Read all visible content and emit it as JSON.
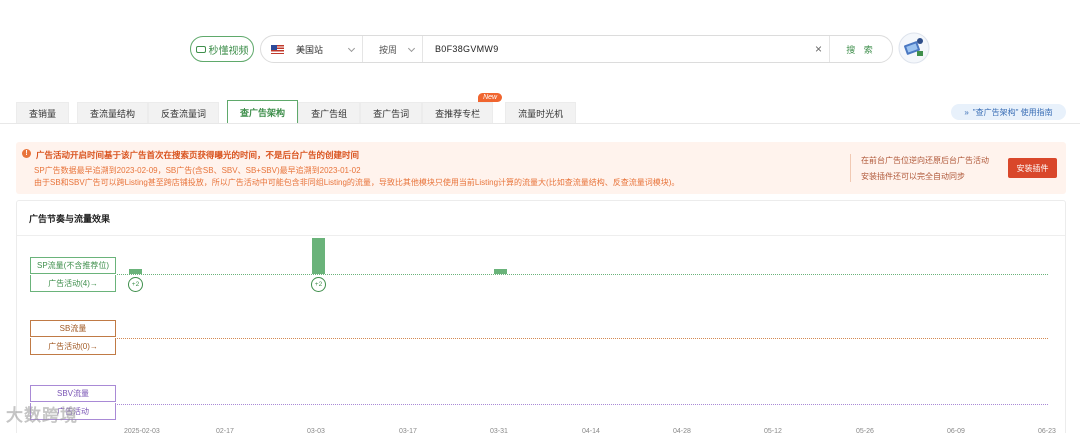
{
  "search": {
    "video_label": "秒懂视频",
    "site": "美国站",
    "type": "按周",
    "query": "B0F38GVMW9",
    "clear": "×",
    "button": "搜 索"
  },
  "tabs": [
    {
      "label": "查销量"
    },
    {
      "label": "查流量结构"
    },
    {
      "label": "反查流量词"
    },
    {
      "label": "查广告架构"
    },
    {
      "label": "查广告组"
    },
    {
      "label": "查广告词"
    },
    {
      "label": "查推荐专栏"
    },
    {
      "label": "流量时光机"
    }
  ],
  "tab_new_badge": "New",
  "guide_link": "\"查广告架构\" 使用指南",
  "notice": {
    "title": "广告活动开启时间基于该广告首次在搜索页获得曝光的时间，不是后台广告的创建时间",
    "line1": "SP广告数据最早追溯到2023-02-09，SB广告(含SB、SBV、SB+SBV)最早追溯到2023-01-02",
    "line2": "由于SB和SBV广告可以跨Listing甚至跨店铺投放，所以广告活动中可能包含非同组Listing的流量，导致比其他模块只使用当前Listing计算的流量大(比如查流量结构、反查流量词模块)。",
    "right1": "在前台广告位逆向还原后台广告活动",
    "right2": "安装插件还可以完全自动同步",
    "install_button": "安装插件"
  },
  "panel": {
    "title": "广告节奏与流量效果",
    "rows": [
      {
        "label": "SP流量(不含推荐位)",
        "sub": "广告活动(4)→"
      },
      {
        "label": "SB流量",
        "sub": "广告活动(0)→"
      },
      {
        "label": "SBV流量",
        "sub": "广告活动"
      }
    ],
    "badges": [
      "+2",
      "+2"
    ],
    "sp_bars": [
      0.13,
      1.0,
      0.13
    ]
  },
  "x_ticks": [
    "2025-02-03",
    "02-17",
    "03-03",
    "03-17",
    "03-31",
    "04-14",
    "04-28",
    "05-12",
    "05-26",
    "06-09",
    "06-23"
  ],
  "watermark": "大数跨境",
  "colors": {
    "brand_green": "#3f8f4c",
    "notice_bg": "#fff3ed",
    "install_red": "#d9472b",
    "sb_brown": "#a15a24",
    "sbv_purple": "#7a55b5"
  }
}
